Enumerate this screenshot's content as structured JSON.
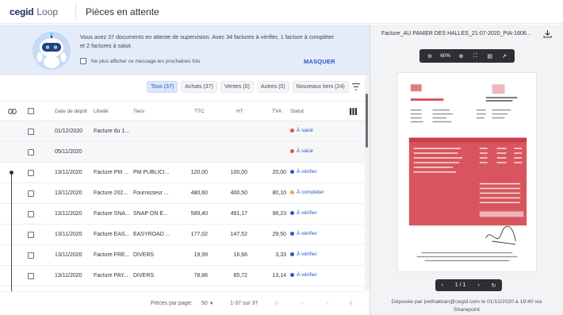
{
  "header": {
    "logo": "cegid",
    "app_name": "Loop",
    "page_title": "Pièces en attente"
  },
  "banner": {
    "message": "Vous avez 37 documents en attente de supervision. Avec 34 factures à vérifier, 1 facture à compléter et 2 factures à saisir.",
    "checkbox_label": "Ne plus afficher ce message les prochaines fois",
    "hide_label": "MASQUER"
  },
  "filters": [
    {
      "label": "Tous (37)",
      "active": true
    },
    {
      "label": "Achats (37)",
      "active": false
    },
    {
      "label": "Ventes (0)",
      "active": false
    },
    {
      "label": "Autres (0)",
      "active": false
    },
    {
      "label": "Nouveaux tiers (24)",
      "active": false
    }
  ],
  "table": {
    "headers": {
      "date": "Date de dépôt",
      "libelle": "Libellé",
      "tiers": "Tiers",
      "ttc": "TTC",
      "ht": "HT",
      "tva": "TVA",
      "statut": "Statut"
    },
    "rows": [
      {
        "date": "01/12/2020",
        "libelle": "Facture du 1...",
        "tiers": "",
        "ttc": "",
        "ht": "",
        "tva": "",
        "status": "À saisir",
        "status_color": "#e0543b"
      },
      {
        "date": "05/11/2020",
        "libelle": "",
        "tiers": "",
        "ttc": "",
        "ht": "",
        "tva": "",
        "status": "À saisir",
        "status_color": "#e0543b"
      },
      {
        "date": "13/11/2020",
        "libelle": "Facture PM ...",
        "tiers": "PM PUBLICI...",
        "ttc": "120,00",
        "ht": "100,00",
        "tva": "20,00",
        "status": "À vérifier",
        "status_color": "#2b57c5"
      },
      {
        "date": "13/11/2020",
        "libelle": "Facture 202...",
        "tiers": "Fournisseur ...",
        "ttc": "480,60",
        "ht": "400,50",
        "tva": "80,10",
        "status": "À compléter",
        "status_color": "#f0a63a"
      },
      {
        "date": "13/11/2020",
        "libelle": "Facture SNA...",
        "tiers": "SNAP ON E...",
        "ttc": "589,40",
        "ht": "491,17",
        "tva": "98,23",
        "status": "À vérifier",
        "status_color": "#2b57c5"
      },
      {
        "date": "13/11/2020",
        "libelle": "Facture EAS...",
        "tiers": "EASYROAD ...",
        "ttc": "177,02",
        "ht": "147,52",
        "tva": "29,50",
        "status": "À vérifier",
        "status_color": "#2b57c5"
      },
      {
        "date": "13/11/2020",
        "libelle": "Facture FRE...",
        "tiers": "DIVERS",
        "ttc": "19,99",
        "ht": "16,66",
        "tva": "3,33",
        "status": "À vérifier",
        "status_color": "#2b57c5"
      },
      {
        "date": "13/11/2020",
        "libelle": "Facture PAY...",
        "tiers": "DIVERS",
        "ttc": "78,86",
        "ht": "65,72",
        "tva": "13,14",
        "status": "À vérifier",
        "status_color": "#2b57c5"
      }
    ]
  },
  "pager": {
    "per_page_label": "Pièces par page:",
    "per_page_value": "50",
    "range": "1-37 sur 37"
  },
  "viewer": {
    "filename": "Facture_AU PANIER DES HALLES_21-07-2020_PIA-1606...",
    "zoom": "60%",
    "page_indicator": "1 / 1",
    "deposit_line1": "Déposée par jvethakkan@cegid.com le 01/12/2020 à 19:40 via",
    "deposit_line2": "Sharepoint"
  },
  "icons": {
    "link": "link-icon",
    "columns": "columns-icon",
    "filter": "filter-icon",
    "download": "download-icon"
  },
  "colors": {
    "accent": "#2b57c5",
    "banner_bg": "#e4ecfa",
    "status_saisir": "#e0543b",
    "status_completer": "#f0a63a",
    "status_verifier": "#2b57c5"
  }
}
